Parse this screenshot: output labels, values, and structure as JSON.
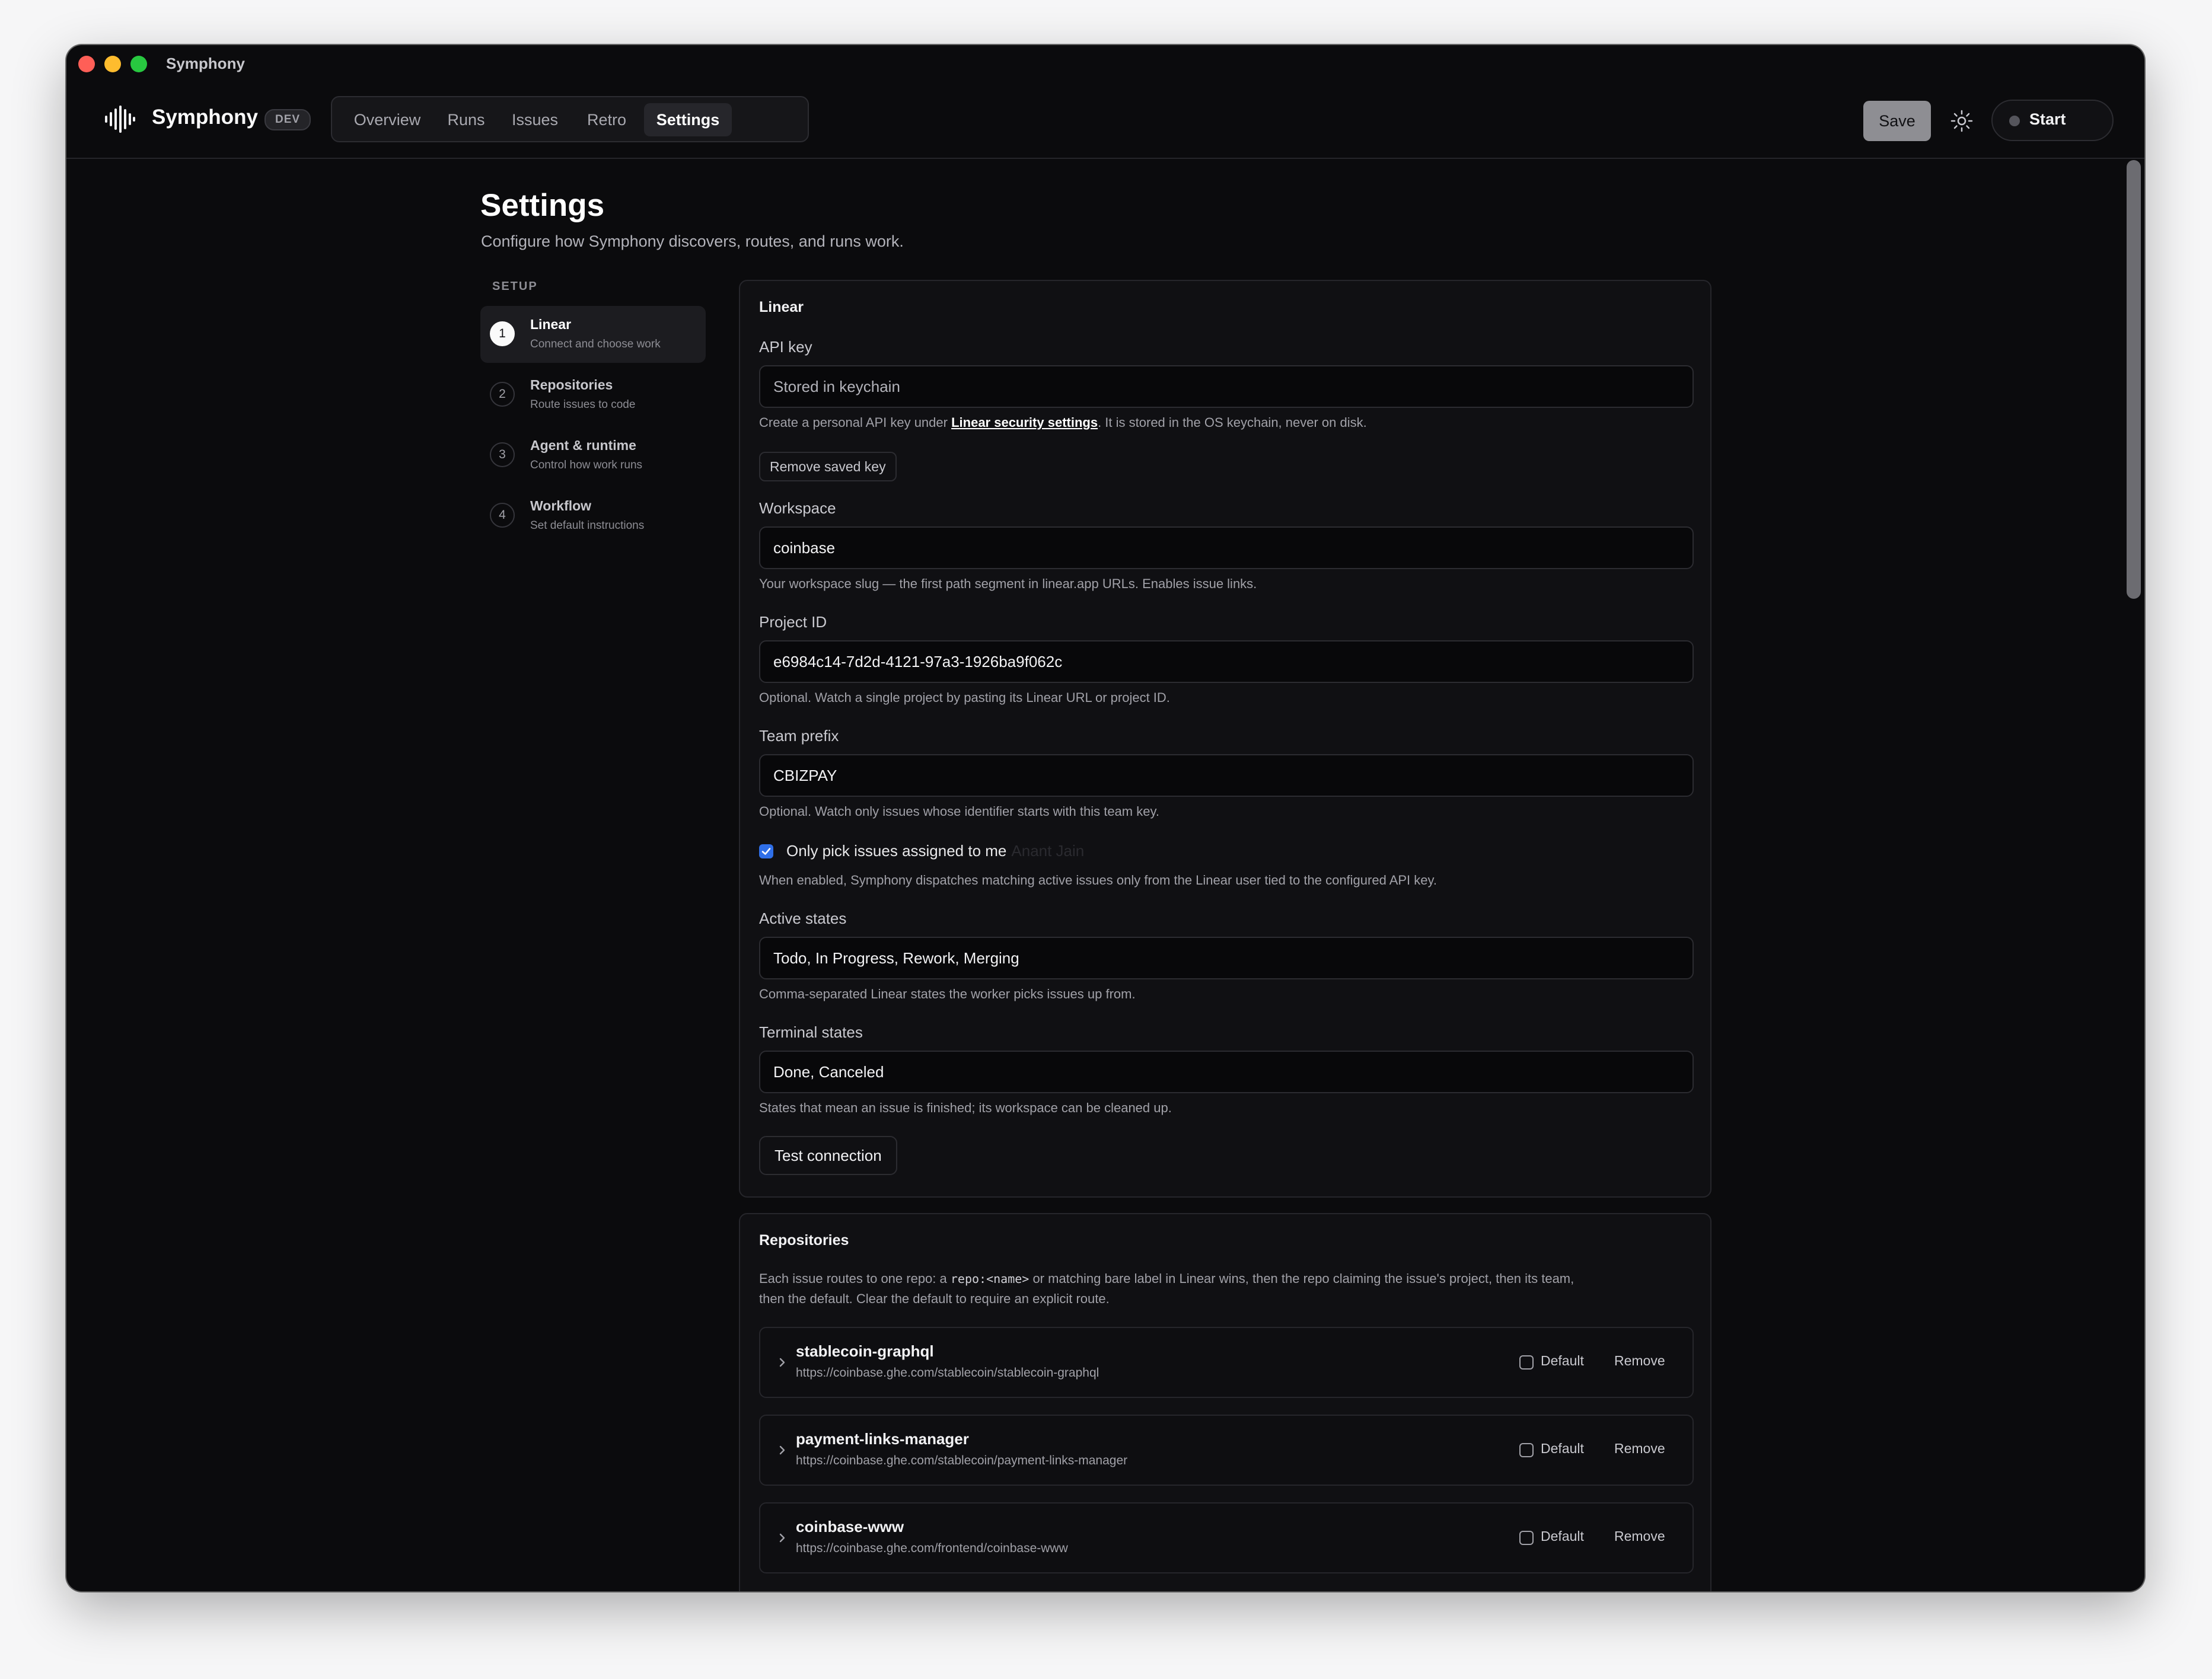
{
  "window": {
    "title": "Symphony"
  },
  "header": {
    "brand": "Symphony",
    "badge": "DEV",
    "tabs": [
      {
        "label": "Overview",
        "active": false
      },
      {
        "label": "Runs",
        "active": false
      },
      {
        "label": "Issues",
        "active": false
      },
      {
        "label": "Retro",
        "active": false
      },
      {
        "label": "Settings",
        "active": true
      }
    ],
    "save_label": "Save",
    "theme_icon": "sun-icon",
    "start_label": "Start"
  },
  "page": {
    "title": "Settings",
    "subtitle": "Configure how Symphony discovers, routes, and runs work."
  },
  "setup": {
    "heading": "SETUP",
    "steps": [
      {
        "num": "1",
        "title": "Linear",
        "desc": "Connect and choose work",
        "active": true
      },
      {
        "num": "2",
        "title": "Repositories",
        "desc": "Route issues to code",
        "active": false
      },
      {
        "num": "3",
        "title": "Agent & runtime",
        "desc": "Control how work runs",
        "active": false
      },
      {
        "num": "4",
        "title": "Workflow",
        "desc": "Set default instructions",
        "active": false
      }
    ]
  },
  "linear": {
    "title": "Linear",
    "api_key": {
      "label": "API key",
      "placeholder": "Stored in keychain",
      "help_prefix": "Create a personal API key under ",
      "help_link": "Linear security settings",
      "help_suffix": ". It is stored in the OS keychain, never on disk.",
      "remove_label": "Remove saved key"
    },
    "workspace": {
      "label": "Workspace",
      "value": "coinbase",
      "help": "Your workspace slug — the first path segment in linear.app URLs. Enables issue links."
    },
    "project_id": {
      "label": "Project ID",
      "value": "e6984c14-7d2d-4121-97a3-1926ba9f062c",
      "help": "Optional. Watch a single project by pasting its Linear URL or project ID."
    },
    "team_prefix": {
      "label": "Team prefix",
      "value": "CBIZPAY",
      "help": "Optional. Watch only issues whose identifier starts with this team key."
    },
    "assigned_only": {
      "checked": true,
      "label": "Only pick issues assigned to me",
      "user": "Anant Jain",
      "help": "When enabled, Symphony dispatches matching active issues only from the Linear user tied to the configured API key."
    },
    "active_states": {
      "label": "Active states",
      "value": "Todo, In Progress, Rework, Merging",
      "help": "Comma-separated Linear states the worker picks issues up from."
    },
    "terminal_states": {
      "label": "Terminal states",
      "value": "Done, Canceled",
      "help": "States that mean an issue is finished; its workspace can be cleaned up."
    },
    "test_label": "Test connection"
  },
  "repositories": {
    "title": "Repositories",
    "desc_1a": "Each issue routes to one repo: a ",
    "desc_code": "repo:<name>",
    "desc_1b": " or matching bare label in Linear wins, then the repo claiming the issue's project, then its team,",
    "desc_2": "then the default. Clear the default to require an explicit route.",
    "default_label": "Default",
    "remove_label": "Remove",
    "items": [
      {
        "name": "stablecoin-graphql",
        "url": "https://coinbase.ghe.com/stablecoin/stablecoin-graphql"
      },
      {
        "name": "payment-links-manager",
        "url": "https://coinbase.ghe.com/stablecoin/payment-links-manager"
      },
      {
        "name": "coinbase-www",
        "url": "https://coinbase.ghe.com/frontend/coinbase-www"
      }
    ]
  }
}
